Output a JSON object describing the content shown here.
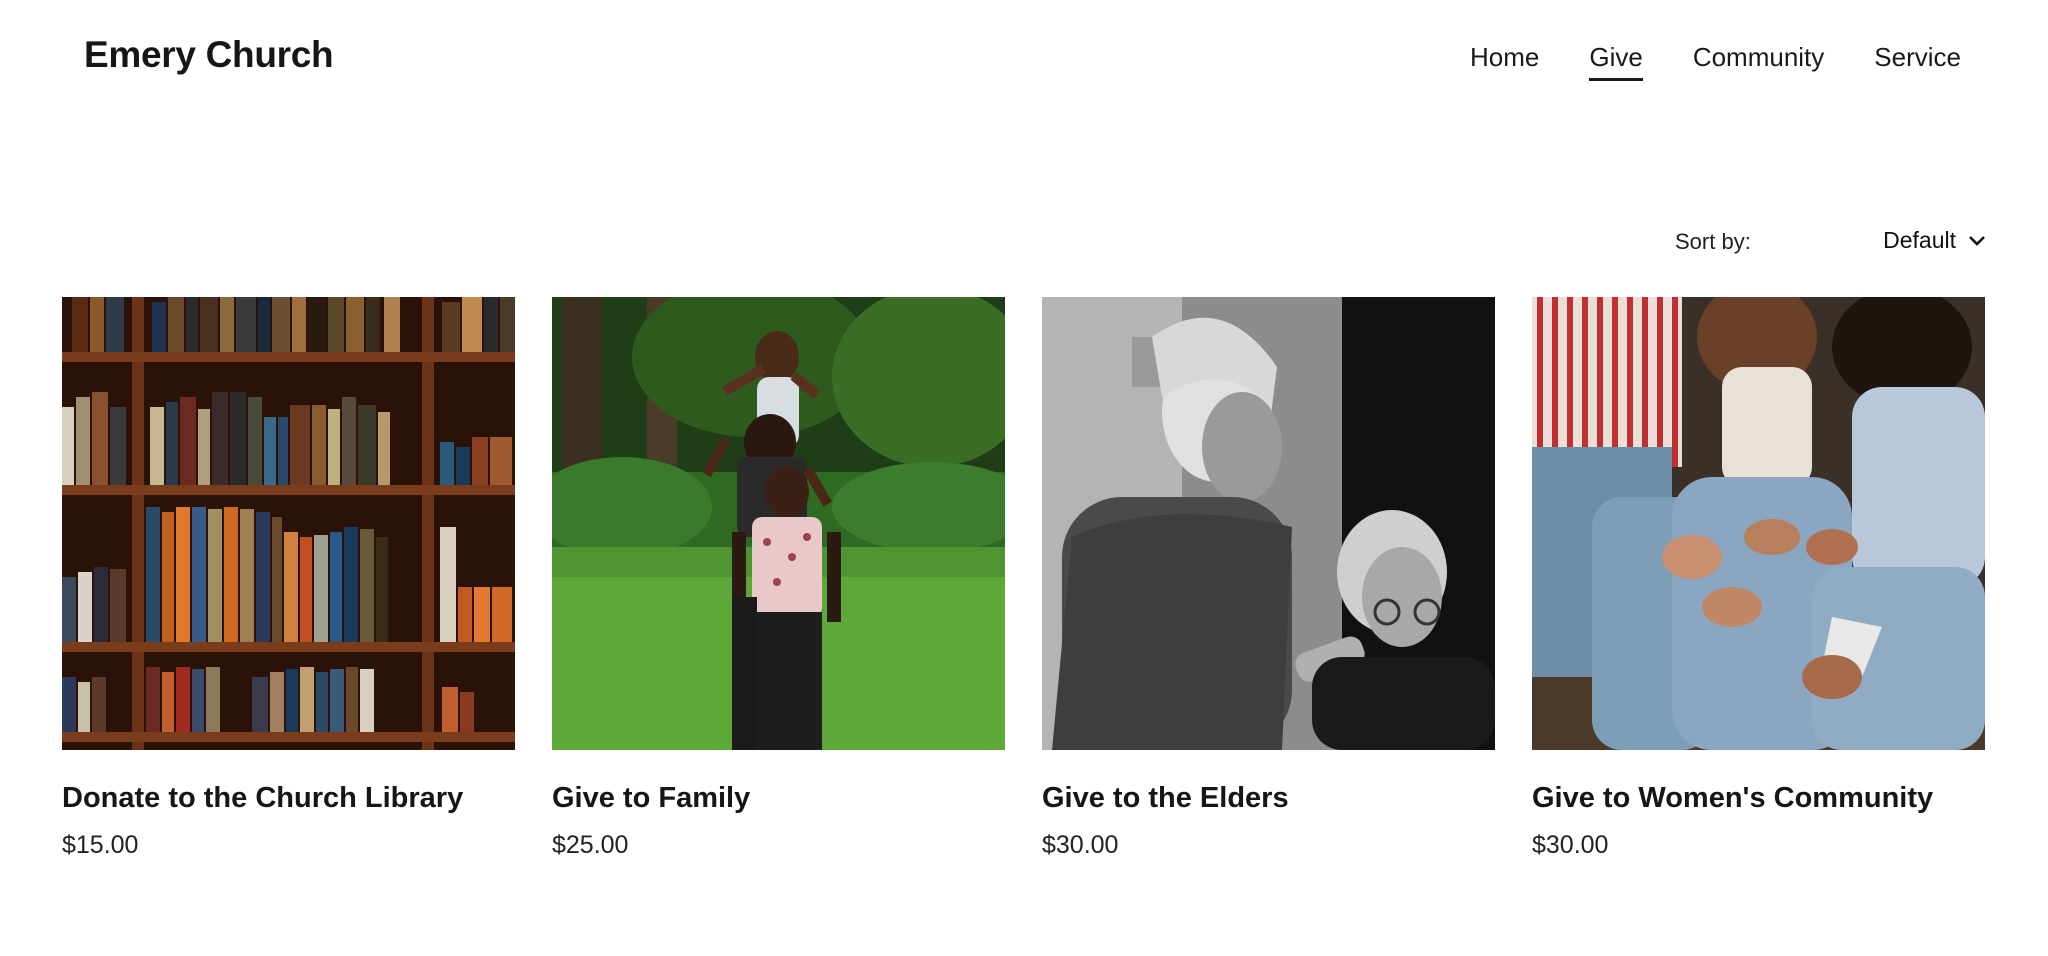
{
  "header": {
    "site_title": "Emery Church",
    "nav": [
      {
        "label": "Home",
        "active": false
      },
      {
        "label": "Give",
        "active": true
      },
      {
        "label": "Community",
        "active": false
      },
      {
        "label": "Service",
        "active": false
      }
    ]
  },
  "sort": {
    "label": "Sort by:",
    "value": "Default",
    "icon": "chevron-down-icon"
  },
  "products": [
    {
      "title": "Donate to the Church Library",
      "price": "$15.00",
      "image": "bookshelf-photo"
    },
    {
      "title": "Give to Family",
      "price": "$25.00",
      "image": "family-photo"
    },
    {
      "title": "Give to the Elders",
      "price": "$30.00",
      "image": "elders-photo"
    },
    {
      "title": "Give to Women's Community",
      "price": "$30.00",
      "image": "women-community-photo"
    }
  ],
  "colors": {
    "text": "#1a1a1a",
    "background": "#ffffff"
  }
}
